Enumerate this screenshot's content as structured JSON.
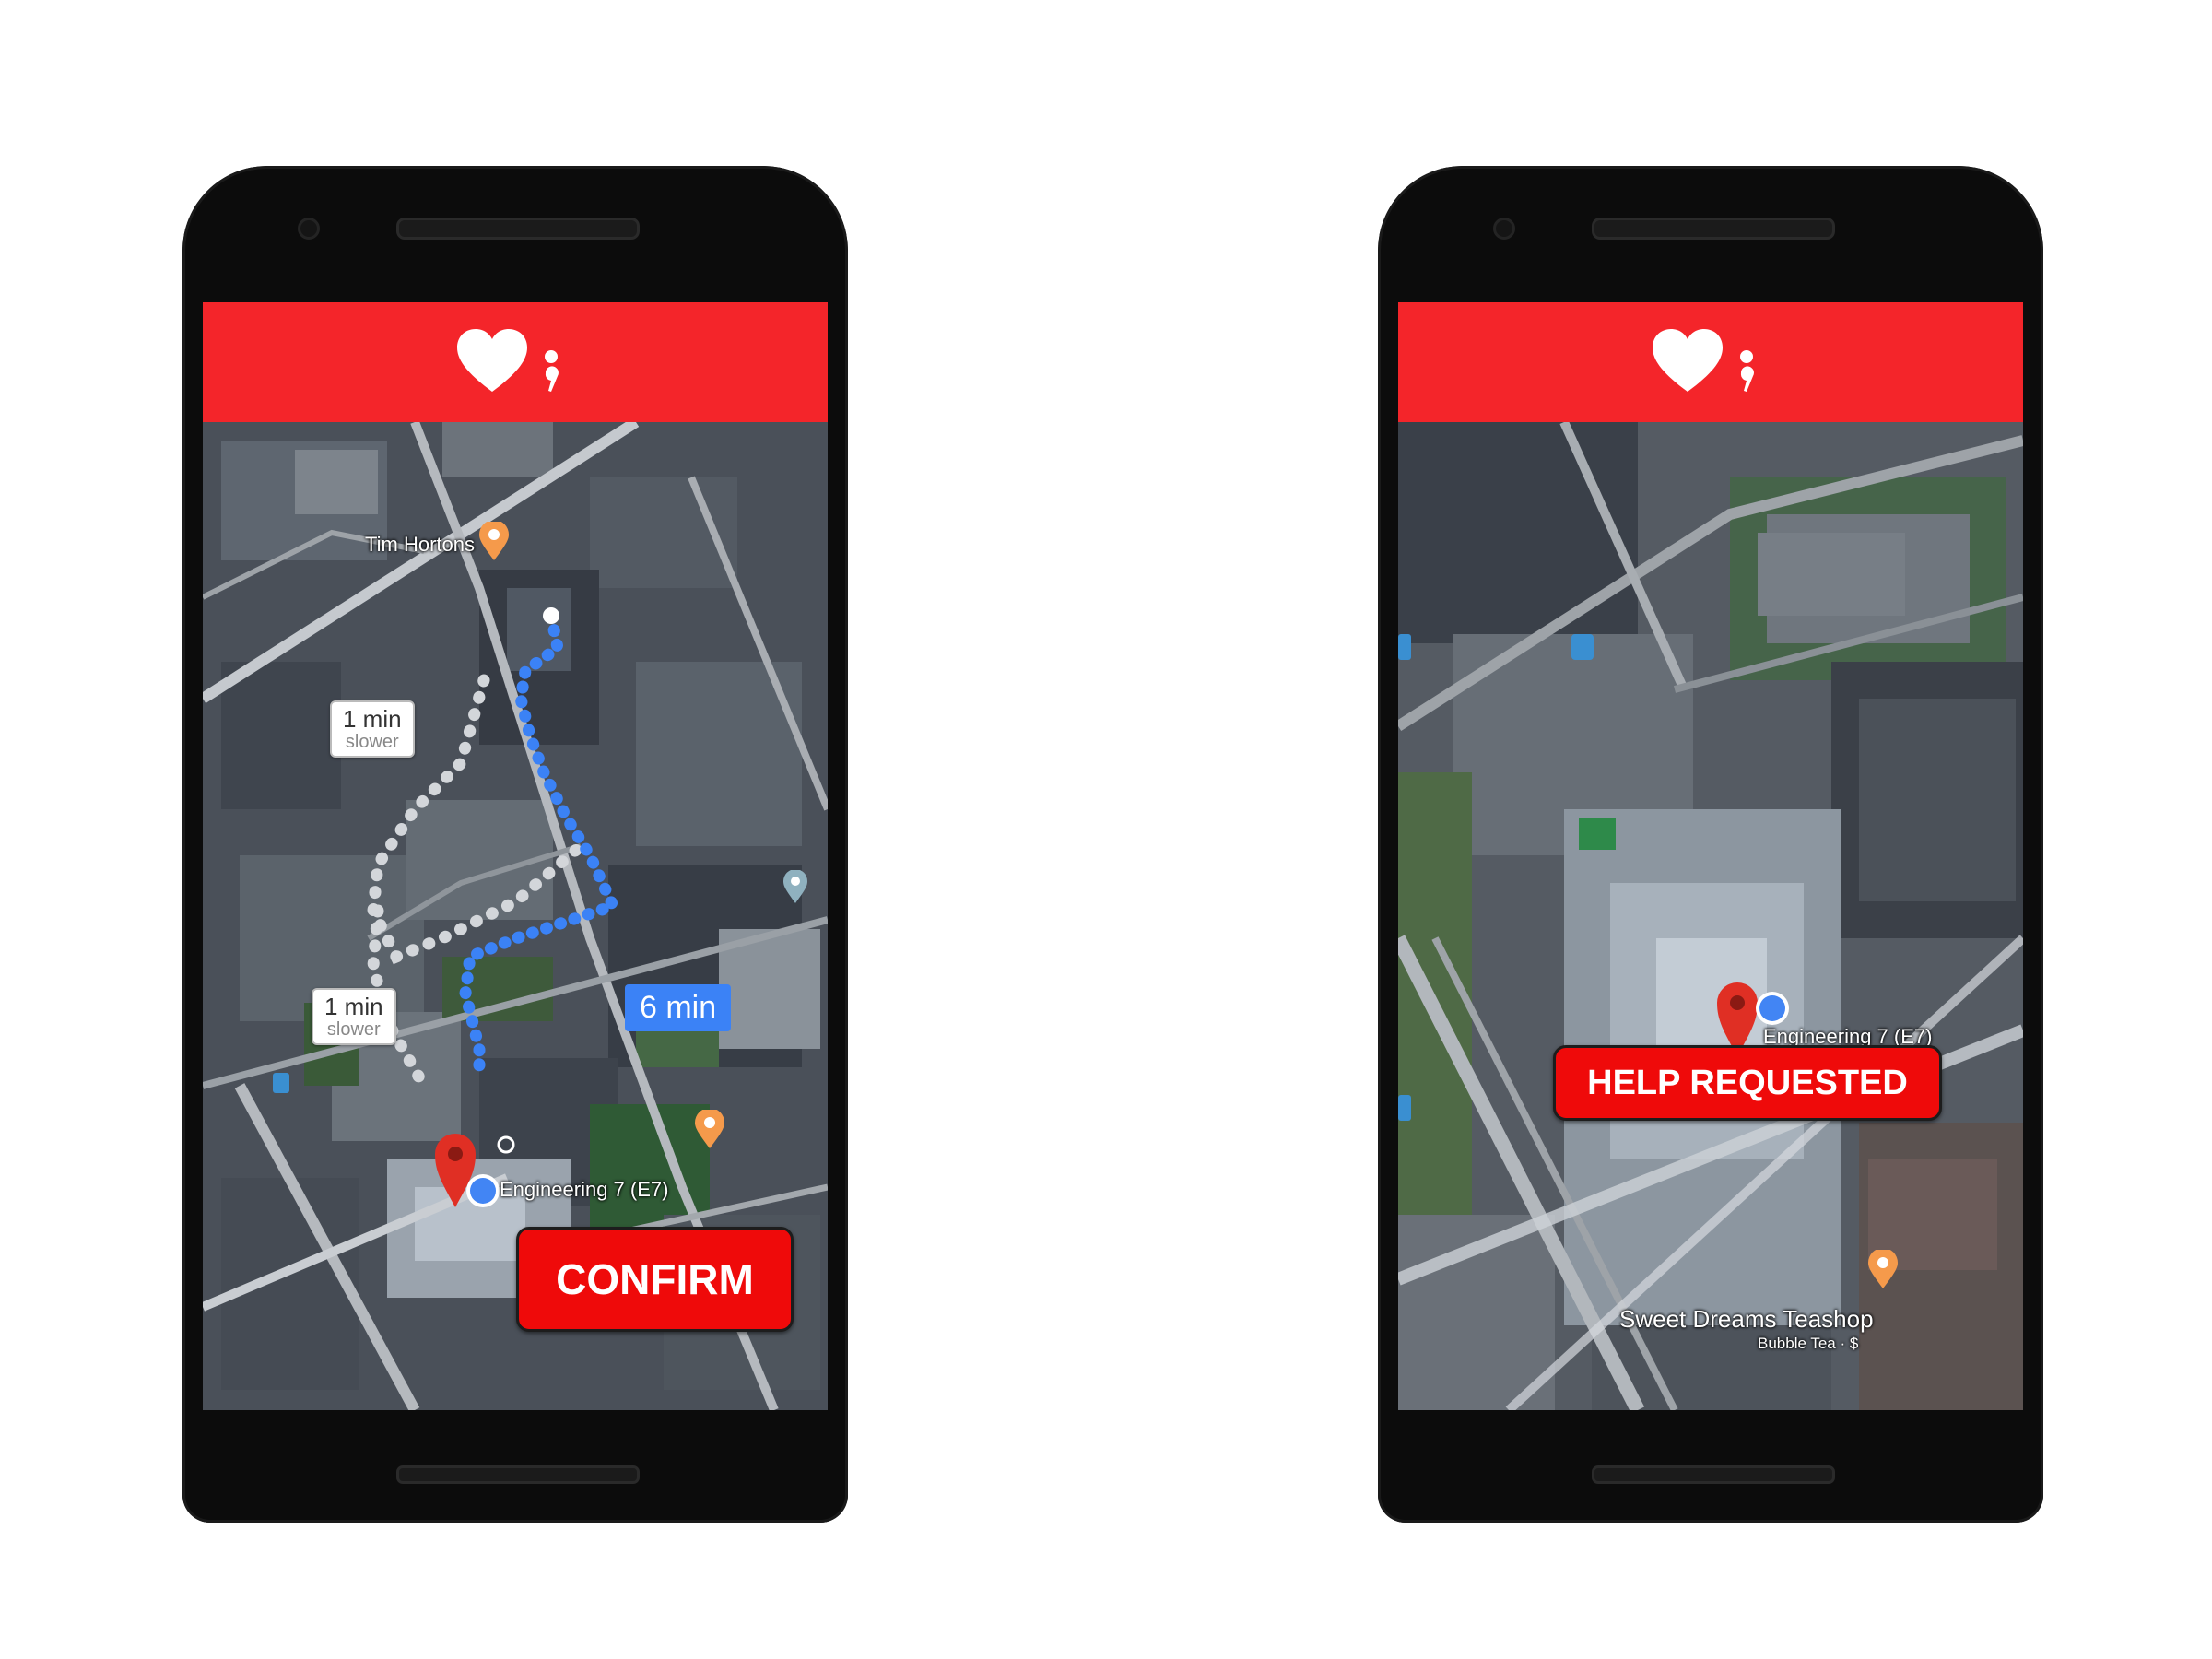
{
  "colors": {
    "brand_red": "#f4252a",
    "button_red": "#ef0a0a",
    "route_blue": "#3b82f6",
    "alt_route_grey": "#cfd3d8"
  },
  "left_screen": {
    "logo_icon": "heart-semicolon-logo",
    "map": {
      "alt_route_tag_1": {
        "line1": "1 min",
        "line2": "slower"
      },
      "alt_route_tag_2": {
        "line1": "1 min",
        "line2": "slower"
      },
      "eta_label": "6 min",
      "places": {
        "tim_hortons": "Tim Hortons",
        "engineering": "Engineering 7 (E7)"
      }
    },
    "confirm_label": "CONFIRM"
  },
  "right_screen": {
    "logo_icon": "heart-semicolon-logo",
    "help_requested_label": "HELP REQUESTED",
    "map": {
      "places": {
        "engineering": "Engineering 7 (E7)",
        "teashop": "Sweet Dreams Teashop",
        "teashop_sub": "Bubble Tea · $"
      }
    }
  }
}
